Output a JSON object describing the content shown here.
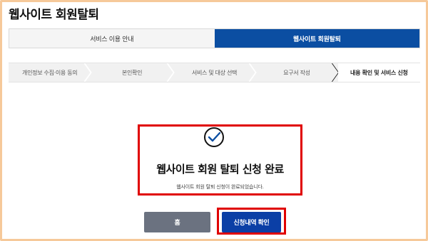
{
  "page": {
    "title": "웹사이트 회원탈퇴"
  },
  "tabs": [
    {
      "label": "서비스 이용 안내",
      "active": false
    },
    {
      "label": "웹사이트 회원탈퇴",
      "active": true
    }
  ],
  "steps": [
    {
      "label": "개인정보 수집·이용 동의",
      "current": false
    },
    {
      "label": "본인확인",
      "current": false
    },
    {
      "label": "서비스 및 대상 선택",
      "current": false
    },
    {
      "label": "요구서 작성",
      "current": false
    },
    {
      "label": "내용 확인 및 서비스 신청",
      "current": true
    }
  ],
  "result": {
    "icon": "check-circle-icon",
    "title": "웹사이트 회원 탈퇴 신청 완료",
    "description": "웹사이트 회원 탈퇴 신청이 완료되었습니다."
  },
  "buttons": {
    "home_label": "홈",
    "check_label": "신청내역 확인"
  },
  "colors": {
    "accent": "#0b4ea2",
    "highlight": "#e00000",
    "frame": "#f6c99a",
    "home_button": "#6b7280"
  }
}
